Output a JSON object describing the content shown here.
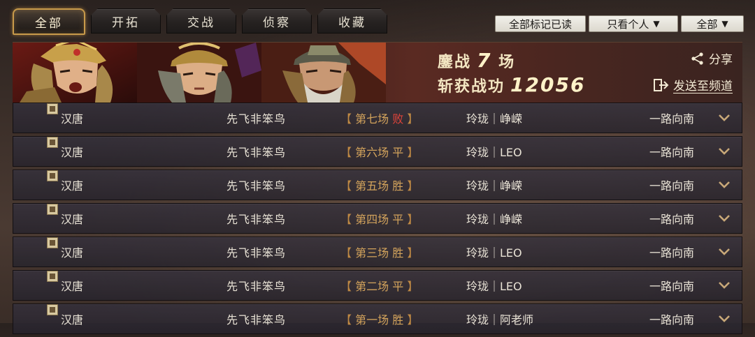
{
  "tabs": [
    {
      "label": "全部",
      "active": true
    },
    {
      "label": "开拓",
      "active": false
    },
    {
      "label": "交战",
      "active": false
    },
    {
      "label": "侦察",
      "active": false
    },
    {
      "label": "收藏",
      "active": false
    }
  ],
  "filters": {
    "mark_all_read": "全部标记已读",
    "view_personal": "只看个人",
    "scope": "全部"
  },
  "banner": {
    "battles_label": "鏖战",
    "battles_count": "7",
    "battles_unit": "场",
    "merit_label": "斩获战功",
    "merit_value": "12056",
    "share": "分享",
    "send_to_channel": "发送至频道"
  },
  "colors": {
    "accent_gold": "#c89a4a",
    "lose_red": "#e0443a",
    "win_gold": "#d4a45c"
  },
  "reports": [
    {
      "left_faction": "汉唐",
      "player": "先飞非笨鸟",
      "match": "第七场",
      "result": "败",
      "result_type": "lose",
      "opponent": "玲珑｜峥嵘",
      "right_faction": "一路向南"
    },
    {
      "left_faction": "汉唐",
      "player": "先飞非笨鸟",
      "match": "第六场",
      "result": "平",
      "result_type": "draw",
      "opponent": "玲珑｜LEO",
      "right_faction": "一路向南"
    },
    {
      "left_faction": "汉唐",
      "player": "先飞非笨鸟",
      "match": "第五场",
      "result": "胜",
      "result_type": "win",
      "opponent": "玲珑｜峥嵘",
      "right_faction": "一路向南"
    },
    {
      "left_faction": "汉唐",
      "player": "先飞非笨鸟",
      "match": "第四场",
      "result": "平",
      "result_type": "draw",
      "opponent": "玲珑｜峥嵘",
      "right_faction": "一路向南"
    },
    {
      "left_faction": "汉唐",
      "player": "先飞非笨鸟",
      "match": "第三场",
      "result": "胜",
      "result_type": "win",
      "opponent": "玲珑｜LEO",
      "right_faction": "一路向南"
    },
    {
      "left_faction": "汉唐",
      "player": "先飞非笨鸟",
      "match": "第二场",
      "result": "平",
      "result_type": "draw",
      "opponent": "玲珑｜LEO",
      "right_faction": "一路向南"
    },
    {
      "left_faction": "汉唐",
      "player": "先飞非笨鸟",
      "match": "第一场",
      "result": "胜",
      "result_type": "win",
      "opponent": "玲珑｜阿老师",
      "right_faction": "一路向南"
    }
  ]
}
